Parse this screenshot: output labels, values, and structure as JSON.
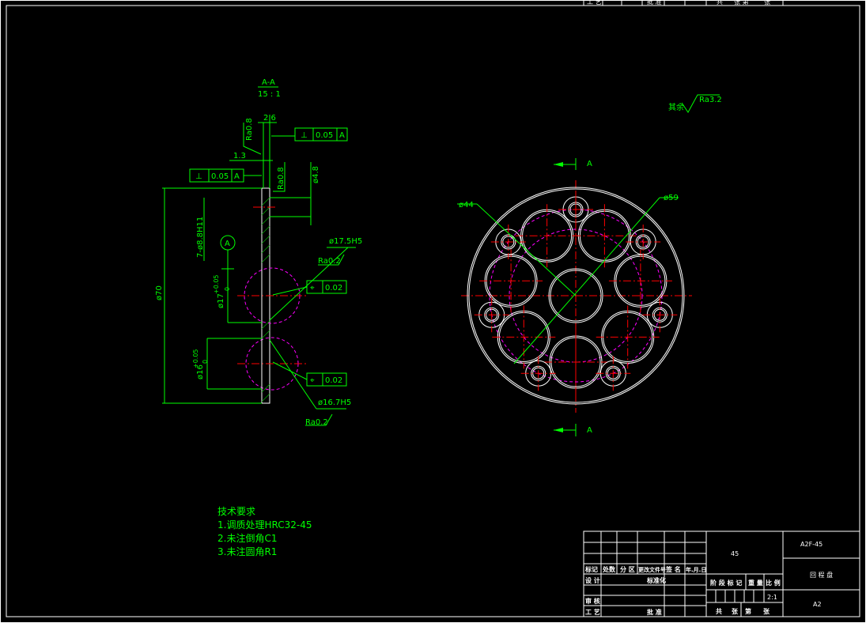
{
  "section": {
    "title": "A-A",
    "scale": "15 : 1",
    "dims": {
      "thickness": "2.6",
      "offset": "1.3",
      "pin_dia": "ø4.8",
      "holes": "7-ø8.8H11",
      "overall": "ø70",
      "bore1": "ø17",
      "bore1_tol_up": "+0.05",
      "bore1_tol_low": "0",
      "bore2": "ø16",
      "bore2_tol_up": "+0.05",
      "bore2_tol_low": "0",
      "callout1": "ø17.5H5",
      "callout2": "ø16.7H5"
    },
    "roughness": {
      "r1": "Ra0.8",
      "r2": "Ra0.8",
      "r3": "Ra0.2",
      "r4": "Ra0.2"
    },
    "gdt": {
      "perp_symbol": "⊥",
      "perp_value": "0.05",
      "datum": "A",
      "pos_symbol": "⌖",
      "pos_value": "0.02"
    },
    "datum_marker": "A"
  },
  "plan_view": {
    "cut_label_top": "A",
    "cut_label_bottom": "A",
    "dim_left": "ø44",
    "dim_right": "ø59",
    "rest_label": "其余",
    "rest_roughness": "Ra3.2"
  },
  "tech_req": {
    "title": "技术要求",
    "items": [
      "1.调质处理HRC32-45",
      "2.未注倒角C1",
      "3.未注圆角R1"
    ]
  },
  "title_block": {
    "top_stub": [
      "工 艺",
      "批 准",
      "共",
      "张 第",
      "张"
    ],
    "cols": [
      "标记",
      "处数",
      "分 区",
      "更改文件号",
      "签 名",
      "年.月.日"
    ],
    "rows": [
      "设 计",
      "标准化",
      "审 核",
      "工 艺",
      "批 准"
    ],
    "material": "45",
    "stage": [
      "阶 段 标 记",
      "重 量",
      "比 例"
    ],
    "scale": "2:1",
    "sheet": [
      "共",
      "张",
      "第",
      "张"
    ],
    "drawing_no": "A2F-45",
    "part_name": "回 程 盘",
    "size": "A2"
  },
  "colors": {
    "dimension": "#00ff00",
    "center": "#ff0000",
    "hidden": "#ff00ff",
    "outline": "#ffffff"
  }
}
